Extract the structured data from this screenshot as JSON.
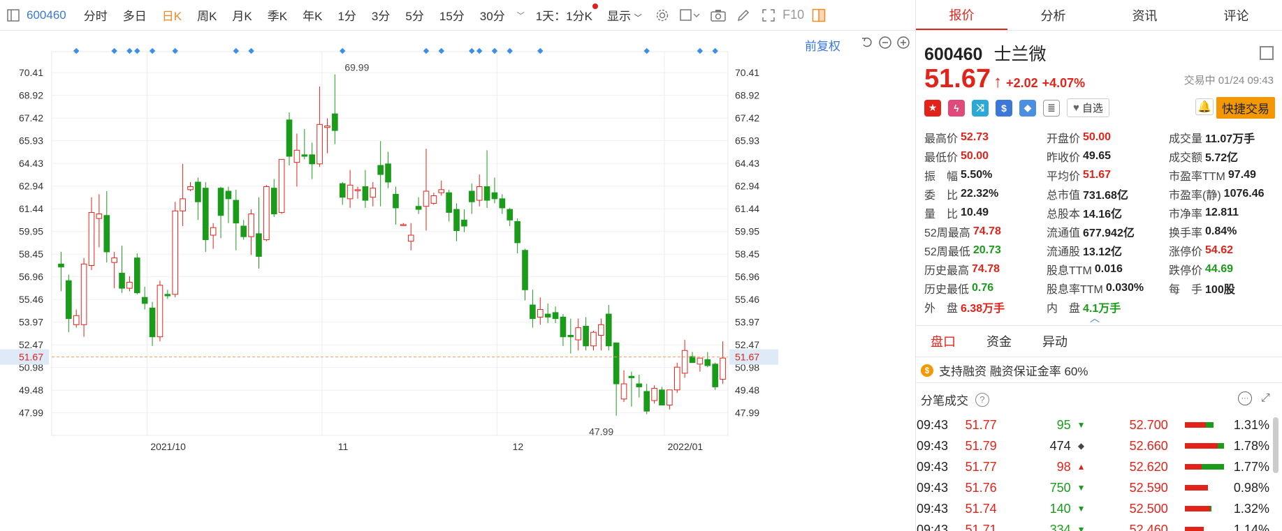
{
  "toolbar": {
    "code": "600460",
    "items": [
      "分时",
      "多日",
      "日K",
      "周K",
      "月K",
      "季K",
      "年K",
      "1分",
      "3分",
      "5分",
      "15分",
      "30分"
    ],
    "active_index": 2,
    "period_select": "1天：1分K",
    "display": "显示",
    "f10": "F10"
  },
  "chart_controls": {
    "fuquan": "前复权"
  },
  "chart_data": {
    "type": "candlestick",
    "y_ticks": [
      "70.41",
      "68.92",
      "67.42",
      "65.93",
      "64.43",
      "62.94",
      "61.44",
      "59.95",
      "58.45",
      "56.96",
      "55.46",
      "53.97",
      "52.47",
      "50.98",
      "49.48",
      "47.99"
    ],
    "ylim": [
      46.5,
      71.8
    ],
    "x_labels": [
      "2021/10",
      "11",
      "12",
      "2022/01"
    ],
    "current_price": 51.67,
    "current_label": "51.67",
    "high_annotation": "69.99",
    "low_annotation": "47.99",
    "candles": [
      [
        57.8,
        58.6,
        56.0,
        57.6
      ],
      [
        56.7,
        57.1,
        53.3,
        54.2
      ],
      [
        53.8,
        54.8,
        53.6,
        54.4
      ],
      [
        53.8,
        58.2,
        53.0,
        57.8
      ],
      [
        57.7,
        62.2,
        57.4,
        61.2
      ],
      [
        60.8,
        62.4,
        58.9,
        61.1
      ],
      [
        61.0,
        62.6,
        57.9,
        58.6
      ],
      [
        57.9,
        58.6,
        56.2,
        58.2
      ],
      [
        57.2,
        59.0,
        55.9,
        56.2
      ],
      [
        56.2,
        57.0,
        56.0,
        56.6
      ],
      [
        58.2,
        58.5,
        55.8,
        55.9
      ],
      [
        55.6,
        56.3,
        54.8,
        55.2
      ],
      [
        54.9,
        55.3,
        52.4,
        53.0
      ],
      [
        53.0,
        56.7,
        52.7,
        56.4
      ],
      [
        55.8,
        56.1,
        55.5,
        55.7
      ],
      [
        55.8,
        61.9,
        55.6,
        61.3
      ],
      [
        61.3,
        64.4,
        60.3,
        62.1
      ],
      [
        62.7,
        63.2,
        62.6,
        62.9
      ],
      [
        63.2,
        63.5,
        60.7,
        61.9
      ],
      [
        62.8,
        63.2,
        58.6,
        59.4
      ],
      [
        59.7,
        60.5,
        58.8,
        60.2
      ],
      [
        62.8,
        62.9,
        59.5,
        61.0
      ],
      [
        62.6,
        62.9,
        60.5,
        62.1
      ],
      [
        62.0,
        62.7,
        58.7,
        60.5
      ],
      [
        60.3,
        60.7,
        59.4,
        59.6
      ],
      [
        59.6,
        61.4,
        58.4,
        61.1
      ],
      [
        59.8,
        62.2,
        57.5,
        58.3
      ],
      [
        59.4,
        63.0,
        59.3,
        62.9
      ],
      [
        62.8,
        63.4,
        60.9,
        61.1
      ],
      [
        61.2,
        64.5,
        61.1,
        64.7
      ],
      [
        67.3,
        67.8,
        64.3,
        64.9
      ],
      [
        64.5,
        66.4,
        62.9,
        65.3
      ],
      [
        65.0,
        66.7,
        64.7,
        64.9
      ],
      [
        65.0,
        65.8,
        63.4,
        64.4
      ],
      [
        64.4,
        69.5,
        64.2,
        67.0
      ],
      [
        66.8,
        67.4,
        65.1,
        66.9
      ],
      [
        67.7,
        70.3,
        65.7,
        66.6
      ],
      [
        63.1,
        63.2,
        61.7,
        62.2
      ],
      [
        62.1,
        64.0,
        61.5,
        63.0
      ],
      [
        62.7,
        62.9,
        62.1,
        62.7
      ],
      [
        62.9,
        64.0,
        61.5,
        62.0
      ],
      [
        62.2,
        63.2,
        61.6,
        62.8
      ],
      [
        64.3,
        65.9,
        61.6,
        63.7
      ],
      [
        64.4,
        65.2,
        62.8,
        63.2
      ],
      [
        62.4,
        62.9,
        60.4,
        61.5
      ],
      [
        60.4,
        60.5,
        60.3,
        60.4
      ],
      [
        59.3,
        60.5,
        58.7,
        59.7
      ],
      [
        61.6,
        62.2,
        61.1,
        61.4
      ],
      [
        61.6,
        65.4,
        60.0,
        62.6
      ],
      [
        61.8,
        62.5,
        61.7,
        62.3
      ],
      [
        62.5,
        63.3,
        62.3,
        62.7
      ],
      [
        62.5,
        62.7,
        60.6,
        61.2
      ],
      [
        61.4,
        61.8,
        59.3,
        60.0
      ],
      [
        60.7,
        61.4,
        59.9,
        60.3
      ],
      [
        62.6,
        63.1,
        61.1,
        61.9
      ],
      [
        62.0,
        63.7,
        61.6,
        62.9
      ],
      [
        62.9,
        65.3,
        61.5,
        62.0
      ],
      [
        62.5,
        63.5,
        61.8,
        62.1
      ],
      [
        62.1,
        62.4,
        61.1,
        61.5
      ],
      [
        61.4,
        61.5,
        60.3,
        60.7
      ],
      [
        60.6,
        60.8,
        58.5,
        59.2
      ],
      [
        58.7,
        58.8,
        55.4,
        56.1
      ],
      [
        55.1,
        56.1,
        53.6,
        54.2
      ],
      [
        54.3,
        55.6,
        53.8,
        54.8
      ],
      [
        54.5,
        55.2,
        53.9,
        54.3
      ],
      [
        54.6,
        55.0,
        53.9,
        54.2
      ],
      [
        54.3,
        54.5,
        52.4,
        53.0
      ],
      [
        53.1,
        54.2,
        51.9,
        53.0
      ],
      [
        52.8,
        54.2,
        52.1,
        53.6
      ],
      [
        53.7,
        54.3,
        52.1,
        52.4
      ],
      [
        52.4,
        53.4,
        52.1,
        53.3
      ],
      [
        53.1,
        54.2,
        52.1,
        53.8
      ],
      [
        54.5,
        55.1,
        52.1,
        52.4
      ],
      [
        52.6,
        52.5,
        47.8,
        49.9
      ],
      [
        48.9,
        50.8,
        48.7,
        49.9
      ],
      [
        50.4,
        50.7,
        48.4,
        50.3
      ],
      [
        49.9,
        50.5,
        49.0,
        49.7
      ],
      [
        49.4,
        49.9,
        47.9,
        48.1
      ],
      [
        48.8,
        49.8,
        48.6,
        49.6
      ],
      [
        49.5,
        49.7,
        48.7,
        48.5
      ],
      [
        48.5,
        49.5,
        48.2,
        49.5
      ],
      [
        49.5,
        51.3,
        49.3,
        51.0
      ],
      [
        50.6,
        52.8,
        50.3,
        52.1
      ],
      [
        51.7,
        52.0,
        51.4,
        51.3
      ],
      [
        51.2,
        51.4,
        50.7,
        51.6
      ],
      [
        51.5,
        52.0,
        51.0,
        51.1
      ],
      [
        51.2,
        51.3,
        49.5,
        49.7
      ],
      [
        50.2,
        52.7,
        49.9,
        51.6
      ]
    ],
    "markers": [
      2,
      7,
      9,
      10,
      12,
      15,
      23,
      25,
      37,
      48,
      50,
      54,
      55,
      57,
      59,
      63,
      77,
      84,
      86
    ]
  },
  "panel": {
    "tabs": [
      "报价",
      "分析",
      "资讯",
      "评论"
    ],
    "code": "600460",
    "name": "士兰微",
    "price": "51.67",
    "change": "+2.02",
    "change_pct": "+4.07%",
    "status": "交易中 01/24 09:43",
    "zixuan": "自选",
    "quick_trade": "快捷交易",
    "stats": [
      {
        "label": "最高价",
        "value": "52.73",
        "color": "red"
      },
      {
        "label": "开盘价",
        "value": "50.00",
        "color": "red"
      },
      {
        "label": "成交量",
        "value": "11.07万手",
        "color": "blk"
      },
      {
        "label": "最低价",
        "value": "50.00",
        "color": "red"
      },
      {
        "label": "昨收价",
        "value": "49.65",
        "color": "blk"
      },
      {
        "label": "成交额",
        "value": "5.72亿",
        "color": "blk"
      },
      {
        "label": "振　幅",
        "value": "5.50%",
        "color": "blk"
      },
      {
        "label": "平均价",
        "value": "51.67",
        "color": "red"
      },
      {
        "label": "市盈率TTM",
        "value": "97.49",
        "color": "blk"
      },
      {
        "label": "委　比",
        "value": "22.32%",
        "color": "blk"
      },
      {
        "label": "总市值",
        "value": "731.68亿",
        "color": "blk"
      },
      {
        "label": "市盈率(静)",
        "value": "1076.46",
        "color": "blk"
      },
      {
        "label": "量　比",
        "value": "10.49",
        "color": "blk"
      },
      {
        "label": "总股本",
        "value": "14.16亿",
        "color": "blk"
      },
      {
        "label": "市净率",
        "value": "12.811",
        "color": "blk"
      },
      {
        "label": "52周最高",
        "value": "74.78",
        "color": "red"
      },
      {
        "label": "流通值",
        "value": "677.942亿",
        "color": "blk"
      },
      {
        "label": "换手率",
        "value": "0.84%",
        "color": "blk"
      },
      {
        "label": "52周最低",
        "value": "20.73",
        "color": "green"
      },
      {
        "label": "流通股",
        "value": "13.12亿",
        "color": "blk"
      },
      {
        "label": "涨停价",
        "value": "54.62",
        "color": "red"
      },
      {
        "label": "历史最高",
        "value": "74.78",
        "color": "red"
      },
      {
        "label": "股息TTM",
        "value": "0.016",
        "color": "blk"
      },
      {
        "label": "跌停价",
        "value": "44.69",
        "color": "green"
      },
      {
        "label": "历史最低",
        "value": "0.76",
        "color": "green"
      },
      {
        "label": "股息率TTM",
        "value": "0.030%",
        "color": "blk"
      },
      {
        "label": "每　手",
        "value": "100股",
        "color": "blk"
      },
      {
        "label": "外　盘",
        "value": "6.38万手",
        "color": "red"
      },
      {
        "label": "内　盘",
        "value": "4.1万手",
        "color": "green"
      }
    ],
    "subtabs": [
      "盘口",
      "资金",
      "异动"
    ],
    "margin_text": "支持融资 融资保证金率 60%",
    "trades_title": "分笔成交",
    "trades": [
      {
        "time": "09:43",
        "price": "51.77",
        "vol": "95",
        "dir": "down",
        "lp": "52.700",
        "red": 0.5,
        "green": 0.2,
        "pct": "1.31%"
      },
      {
        "time": "09:43",
        "price": "51.79",
        "vol": "474",
        "dir": "neutral",
        "lp": "52.660",
        "red": 0.8,
        "green": 0.15,
        "pct": "1.78%"
      },
      {
        "time": "09:43",
        "price": "51.77",
        "vol": "98",
        "dir": "up",
        "lp": "52.620",
        "red": 0.4,
        "green": 0.55,
        "pct": "1.77%"
      },
      {
        "time": "09:43",
        "price": "51.76",
        "vol": "750",
        "dir": "down",
        "lp": "52.590",
        "red": 0.55,
        "green": 0,
        "pct": "0.98%"
      },
      {
        "time": "09:43",
        "price": "51.74",
        "vol": "140",
        "dir": "down",
        "lp": "52.500",
        "red": 0.6,
        "green": 0.05,
        "pct": "1.32%"
      },
      {
        "time": "09:43",
        "price": "51.71",
        "vol": "334",
        "dir": "down",
        "lp": "52.460",
        "red": 0.45,
        "green": 0,
        "pct": "1.14%"
      }
    ]
  },
  "colors": {
    "up": "#e2231a",
    "down": "#1a9b1a",
    "accent": "#f08a24",
    "link": "#3b78d8"
  }
}
